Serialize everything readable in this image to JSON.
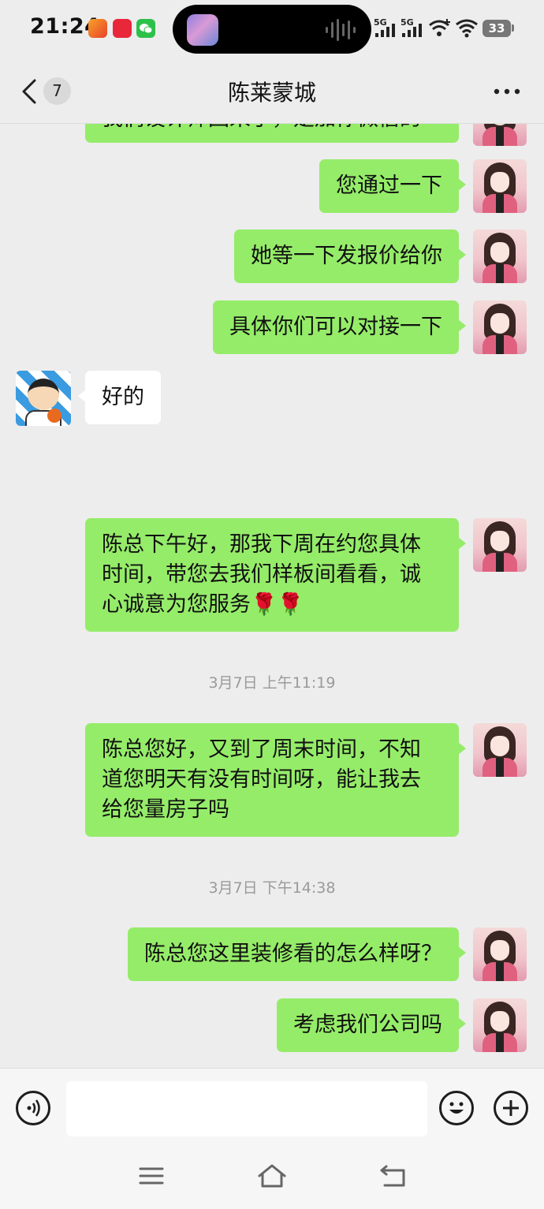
{
  "status_bar": {
    "time": "21:24",
    "notification_icons": [
      "app-icon-orange",
      "app-icon-red",
      "wechat-icon"
    ],
    "notification_badge_text": "小红书",
    "signal_labels": [
      "5G",
      "5G"
    ],
    "battery": "33"
  },
  "header": {
    "unread_count": "7",
    "title": "陈莱蒙城"
  },
  "messages": {
    "partial_top": "我们设计师回来了，是加你微信的",
    "m1": "您通过一下",
    "m2": "她等一下发报价给你",
    "m3": "具体你们可以对接一下",
    "reply1": "好的",
    "m4_line1": "陈总下午好，那我下周在约您具体",
    "m4_line2": "时间，带您去我们样板间看看，诚",
    "m4_line3": "心诚意为您服务🌹🌹",
    "ts1": "3月7日 上午11:19",
    "m5_line1": "陈总您好，又到了周末时间，不知",
    "m5_line2": "道您明天有没有时间呀，能让我去",
    "m5_line3": "给您量房子吗",
    "ts2": "3月7日 下午14:38",
    "m6": "陈总您这里装修看的怎么样呀？",
    "m7": "考虑我们公司吗"
  },
  "input": {
    "placeholder": ""
  },
  "colors": {
    "background": "#ededed",
    "my_bubble": "#95ec69",
    "other_bubble": "#ffffff"
  }
}
